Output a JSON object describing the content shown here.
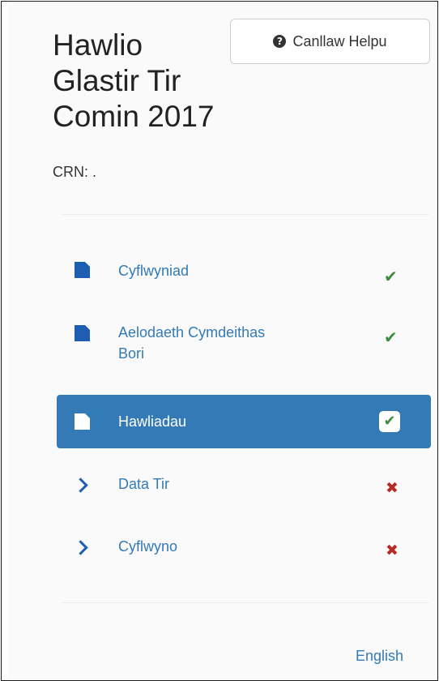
{
  "header": {
    "title": "Hawlio Glastir Tir Comin 2017",
    "help_label": "Canllaw Helpu",
    "help_icon": "question-circle-icon",
    "crn_label": "CRN: ."
  },
  "nav": {
    "items": [
      {
        "label": "Cyflwyniad",
        "icon": "file-icon",
        "status": "complete"
      },
      {
        "label": "Aelodaeth Cymdeithas Bori",
        "icon": "file-icon",
        "status": "complete"
      },
      {
        "label": "Hawliadau",
        "icon": "file-icon",
        "status": "complete",
        "active": true
      },
      {
        "label": "Data Tir",
        "icon": "chevron-right-icon",
        "status": "incomplete"
      },
      {
        "label": "Cyflwyno",
        "icon": "chevron-right-icon",
        "status": "incomplete"
      }
    ]
  },
  "footer": {
    "language_link": "English"
  },
  "colors": {
    "accent": "#337ab7",
    "ok": "#3c8c3c",
    "error": "#b52b27"
  }
}
